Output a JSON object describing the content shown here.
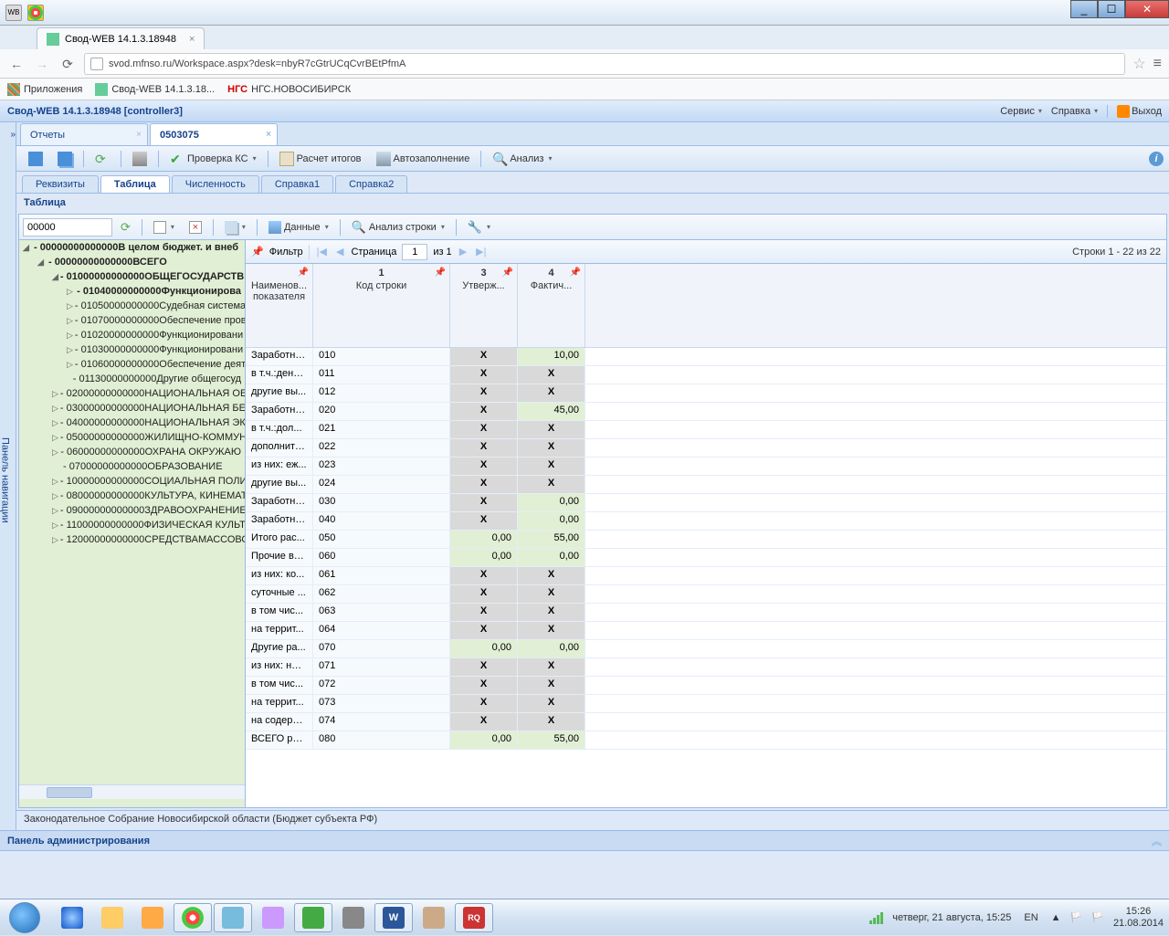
{
  "window": {
    "wb": "WB"
  },
  "browserTab": {
    "title": "Свод-WEB 14.1.3.18948"
  },
  "url": "svod.mfnso.ru/Workspace.aspx?desk=nbyR7cGtrUCqCvrBEtPfmA",
  "bookmarks": {
    "apps": "Приложения",
    "svod": "Свод-WEB 14.1.3.18...",
    "ngs": "НГС.НОВОСИБИРСК",
    "ngsPrefix": "НГС"
  },
  "appTitle": "Свод-WEB 14.1.3.18948 [controller3]",
  "headerMenu": {
    "service": "Сервис",
    "help": "Справка",
    "exit": "Выход"
  },
  "docTabs": {
    "t1": "Отчеты",
    "t2": "0503075"
  },
  "toolbar": {
    "check": "Проверка КС",
    "calc": "Расчет итогов",
    "autofill": "Автозаполнение",
    "analysis": "Анализ"
  },
  "subTabs": {
    "t1": "Реквизиты",
    "t2": "Таблица",
    "t3": "Численность",
    "t4": "Справка1",
    "t5": "Справка2"
  },
  "panelTitle": "Таблица",
  "treeToolbar": {
    "code": "00000",
    "data": "Данные",
    "analysisRow": "Анализ строки"
  },
  "tree": {
    "n0": "- 00000000000000В целом бюджет. и внеб",
    "n1": "- 00000000000000ВСЕГО",
    "n2": "- 01000000000000ОБЩЕГОСУДАРСТВЕ",
    "n3": "- 01040000000000Функционирова",
    "n4": "- 01050000000000Судебная система",
    "n5": "- 01070000000000Обеспечение прове",
    "n6": "- 01020000000000Функционировани",
    "n7": "- 01030000000000Функционировани",
    "n8": "- 01060000000000Обеспечение деят",
    "n9": "- 01130000000000Другие общегосуд",
    "n10": "- 02000000000000НАЦИОНАЛЬНАЯ ОБ",
    "n11": "- 03000000000000НАЦИОНАЛЬНАЯ БЕ",
    "n12": "- 04000000000000НАЦИОНАЛЬНАЯ ЭК",
    "n13": "- 05000000000000ЖИЛИЩНО-КОММУН",
    "n14": "- 06000000000000ОХРАНА ОКРУЖАЮ",
    "n15": "- 07000000000000ОБРАЗОВАНИЕ",
    "n16": "- 10000000000000СОЦИАЛЬНАЯ ПОЛИ",
    "n17": "- 08000000000000КУЛЬТУРА, КИНЕМАТ",
    "n18": "- 09000000000000ЗДРАВООХРАНЕНИЕ",
    "n19": "- 11000000000000ФИЗИЧЕСКАЯ КУЛЬТ",
    "n20": "- 12000000000000СРЕДСТВАМАССОВО"
  },
  "gridToolbar": {
    "filter": "Фильтр",
    "page": "Страница",
    "pageNum": "1",
    "of": "из 1",
    "rowsInfo": "Строки 1 - 22 из 22"
  },
  "gridHead": {
    "c0": "Наименов... показателя",
    "c1n": "1",
    "c1": "Код строки",
    "c3n": "3",
    "c3": "Утверж...",
    "c4n": "4",
    "c4": "Фактич..."
  },
  "rows": [
    {
      "name": "Заработна...",
      "code": "010",
      "c3": "X",
      "c3g": true,
      "c4": "10,00"
    },
    {
      "name": "в т.ч.:дене...",
      "code": "011",
      "c3": "X",
      "c3g": true,
      "c4": "X",
      "c4g": true
    },
    {
      "name": "другие вы...",
      "code": "012",
      "c3": "X",
      "c3g": true,
      "c4": "X",
      "c4g": true
    },
    {
      "name": "Заработна...",
      "code": "020",
      "c3": "X",
      "c3g": true,
      "c4": "45,00"
    },
    {
      "name": "в т.ч.:дол...",
      "code": "021",
      "c3": "X",
      "c3g": true,
      "c4": "X",
      "c4g": true
    },
    {
      "name": "дополните...",
      "code": "022",
      "c3": "X",
      "c3g": true,
      "c4": "X",
      "c4g": true
    },
    {
      "name": "из них: еж...",
      "code": "023",
      "c3": "X",
      "c3g": true,
      "c4": "X",
      "c4g": true
    },
    {
      "name": "другие вы...",
      "code": "024",
      "c3": "X",
      "c3g": true,
      "c4": "X",
      "c4g": true
    },
    {
      "name": "Заработна...",
      "code": "030",
      "c3": "X",
      "c3g": true,
      "c4": "0,00"
    },
    {
      "name": "Заработна...",
      "code": "040",
      "c3": "X",
      "c3g": true,
      "c4": "0,00"
    },
    {
      "name": "Итого рас...",
      "code": "050",
      "c3": "0,00",
      "c4": "55,00"
    },
    {
      "name": "Прочие вы...",
      "code": "060",
      "c3": "0,00",
      "c4": "0,00"
    },
    {
      "name": "из них: ко...",
      "code": "061",
      "c3": "X",
      "c3g": true,
      "c4": "X",
      "c4g": true
    },
    {
      "name": "суточные ...",
      "code": "062",
      "c3": "X",
      "c3g": true,
      "c4": "X",
      "c4g": true
    },
    {
      "name": "в том чис...",
      "code": "063",
      "c3": "X",
      "c3g": true,
      "c4": "X",
      "c4g": true
    },
    {
      "name": "на террит...",
      "code": "064",
      "c3": "X",
      "c3g": true,
      "c4": "X",
      "c4g": true
    },
    {
      "name": "Другие ра...",
      "code": "070",
      "c3": "0,00",
      "c4": "0,00"
    },
    {
      "name": "из них: на ...",
      "code": "071",
      "c3": "X",
      "c3g": true,
      "c4": "X",
      "c4g": true
    },
    {
      "name": "в том чис...",
      "code": "072",
      "c3": "X",
      "c3g": true,
      "c4": "X",
      "c4g": true
    },
    {
      "name": "на террит...",
      "code": "073",
      "c3": "X",
      "c3g": true,
      "c4": "X",
      "c4g": true
    },
    {
      "name": "на содерж...",
      "code": "074",
      "c3": "X",
      "c3g": true,
      "c4": "X",
      "c4g": true
    },
    {
      "name": "ВСЕГО рас...",
      "code": "080",
      "c3": "0,00",
      "c4": "55,00"
    }
  ],
  "statusBar": "Законодательное Собрание Новосибирской области (Бюджет субъекта РФ)",
  "adminPanel": "Панель администрирования",
  "sideRail": "Панель навигации",
  "tray": {
    "lang": "EN",
    "time": "15:26",
    "date": "21.08.2014",
    "dateLong": "четверг, 21 августа, 15:25"
  }
}
